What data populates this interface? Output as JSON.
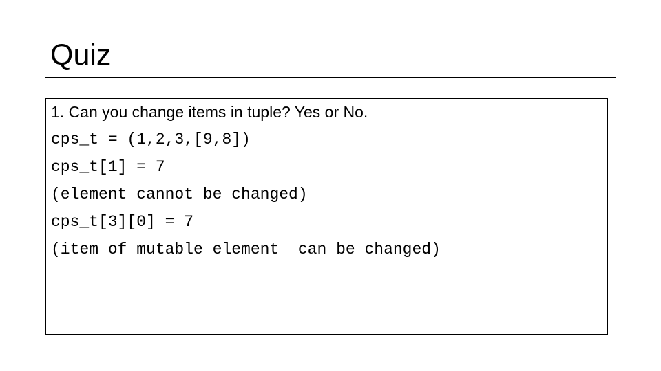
{
  "slide": {
    "title": "Quiz",
    "question": "1. Can you change items in tuple? Yes or No.",
    "code_lines": [
      "cps_t = (1,2,3,[9,8])",
      "cps_t[1] = 7",
      "(element cannot be changed)",
      "cps_t[3][0] = 7",
      "(item of mutable element  can be changed)"
    ]
  }
}
